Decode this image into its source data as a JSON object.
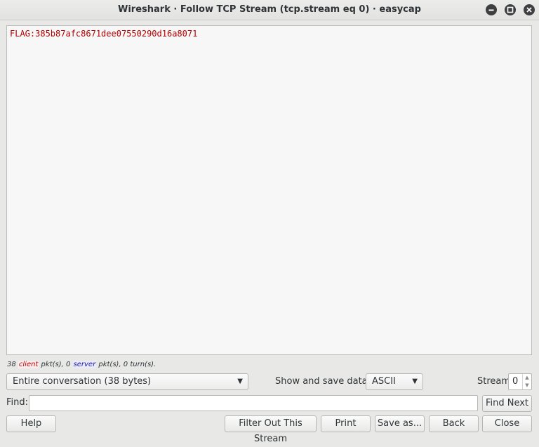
{
  "window": {
    "title": "Wireshark · Follow TCP Stream (tcp.stream eq 0) · easycap"
  },
  "stream": {
    "content": "FLAG:385b87afc8671dee07550290d16a8071"
  },
  "stats": {
    "client_count": "38 ",
    "client_label": "client",
    "client_suffix": " pkt(s), 0 ",
    "server_label": "server",
    "server_suffix": " pkt(s), 0 turn(s)."
  },
  "controls": {
    "conversation_select": "Entire conversation (38 bytes)",
    "show_save_label": "Show and save data as",
    "format_select": "ASCII",
    "stream_label": "Stream",
    "stream_value": "0",
    "find_label": "Find:",
    "find_value": "",
    "find_next_label": "Find Next"
  },
  "buttons": {
    "help": "Help",
    "filter_out": "Filter Out This Stream",
    "print": "Print",
    "save_as": "Save as...",
    "back": "Back",
    "close": "Close"
  },
  "icons": {
    "minimize": "minimize-icon",
    "maximize": "maximize-icon",
    "close": "close-icon",
    "dropdown": "chevron-down-icon",
    "spinner": "spinner-arrows-icon"
  },
  "colors": {
    "client_text": "#b30000",
    "server_text": "#1a1aa6",
    "titlebar_buttons": "#3d3f40"
  }
}
